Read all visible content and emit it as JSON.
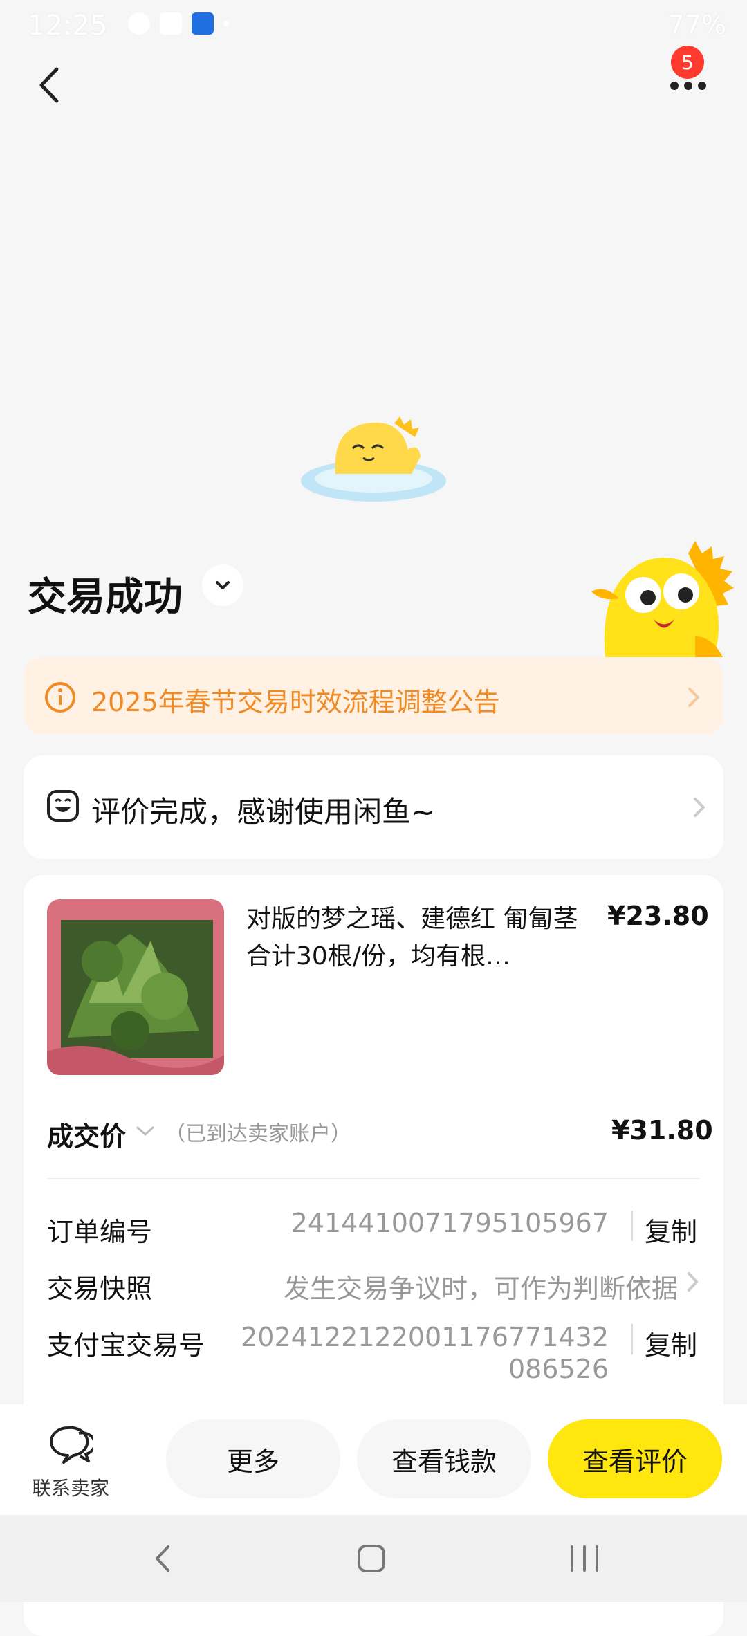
{
  "status_bar": {
    "time": "12:25",
    "battery": "77%"
  },
  "nav": {
    "badge_count": "5"
  },
  "title": "交易成功",
  "notice": {
    "text": "2025年春节交易时效流程调整公告"
  },
  "review": {
    "text": "评价完成，感谢使用闲鱼~"
  },
  "product": {
    "title": "对版的梦之瑶、建德红 匍匐茎合计30根/份，均有根…",
    "price": "¥23.80"
  },
  "final_price": {
    "label": "成交价",
    "note": "（已到达卖家账户）",
    "value": "¥31.80"
  },
  "details": {
    "order_no_label": "订单编号",
    "order_no": "2414410071795105967",
    "copy_label": "复制",
    "snapshot_label": "交易快照",
    "snapshot_value": "发生交易争议时，可作为判断依据",
    "alipay_label": "支付宝交易号",
    "alipay_line1": "2024122122001176771432",
    "alipay_line2": "086526"
  },
  "actions": {
    "contact_seller": "联系卖家",
    "more": "更多",
    "view_payment": "查看钱款",
    "view_review": "查看评价"
  },
  "colors": {
    "accent_yellow": "#ffe60f",
    "notice_orange": "#f08a24",
    "notice_bg": "#fff1e3",
    "badge_red": "#ff3b30"
  }
}
